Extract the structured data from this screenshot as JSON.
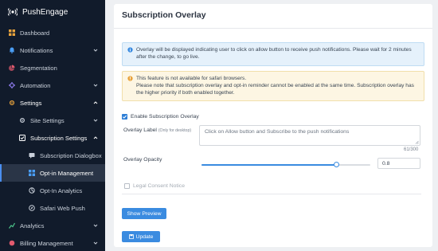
{
  "app": {
    "name": "PushEngage"
  },
  "sidebar": {
    "items": [
      {
        "label": "Dashboard",
        "icon": "dashboard-icon"
      },
      {
        "label": "Notifications",
        "icon": "bell-icon"
      },
      {
        "label": "Segmentation",
        "icon": "segment-icon"
      },
      {
        "label": "Automation",
        "icon": "automation-icon"
      },
      {
        "label": "Settings",
        "icon": "gear-icon"
      },
      {
        "label": "Site Settings",
        "icon": "gear-icon"
      },
      {
        "label": "Subscription Settings",
        "icon": "subscription-icon"
      },
      {
        "label": "Subscription Dialogbox",
        "icon": "dialog-icon"
      },
      {
        "label": "Opt-in Management",
        "icon": "grid-icon"
      },
      {
        "label": "Opt-In Analytics",
        "icon": "analytics-icon"
      },
      {
        "label": "Safari Web Push",
        "icon": "compass-icon"
      },
      {
        "label": "Analytics",
        "icon": "chart-icon"
      },
      {
        "label": "Billing Management",
        "icon": "billing-icon"
      }
    ]
  },
  "main": {
    "title": "Subscription Overlay",
    "info_text": "Overlay will be displayed indicating user to click on allow button to receive push notifications. Please wait for 2 minutes after the change, to go live.",
    "warning_line1": "This feature is not available for safari browsers.",
    "warning_line2": "Please note that subscription overlay and opt-in reminder cannot be enabled at the same time. Subscription overlay has the higher priority if both enabled together.",
    "enable_label": "Enable Subscription Overlay",
    "enable_checked": true,
    "overlay_label": "Overlay Label",
    "overlay_label_hint": "(Only for desktop)",
    "overlay_label_value": "Click on Allow button and Subscribe to the push notifications",
    "char_counter": "61/300",
    "opacity_label": "Overlay Opacity",
    "opacity_value": "0.8",
    "opacity_level": 0.8,
    "legal_label": "Legal Consent Notice",
    "legal_checked": false,
    "preview_button": "Show Preview",
    "update_button": "Update"
  },
  "colors": {
    "sidebar_bg": "#111b2b",
    "accent": "#3a8be0",
    "info_bg": "#e5f1fb",
    "warning_bg": "#fdf6e3"
  }
}
